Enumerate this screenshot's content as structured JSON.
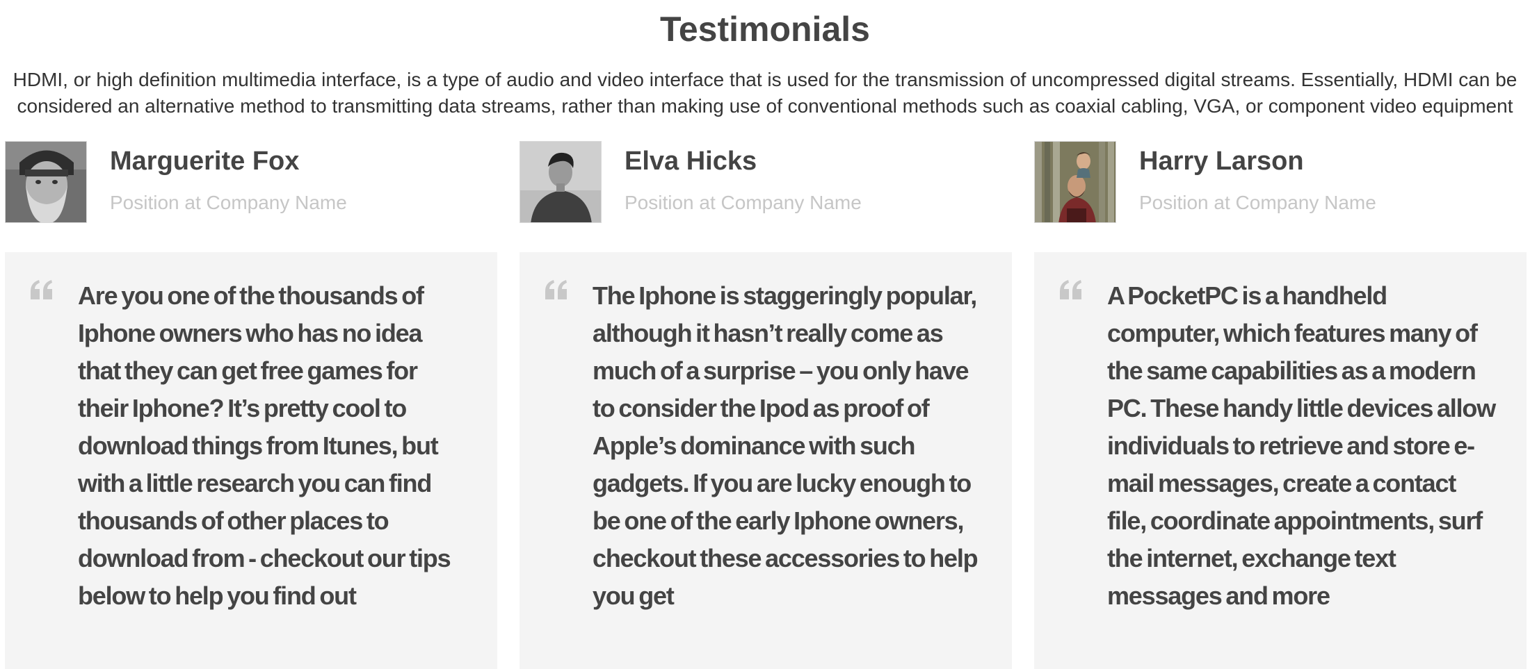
{
  "header": {
    "title": "Testimonials",
    "intro": "HDMI, or high definition multimedia interface, is a type of audio and video interface that is used for the transmission of uncompressed digital streams. Essentially, HDMI can be considered an alternative method to transmitting data streams, rather than making use of conventional methods such as coaxial cabling, VGA, or component video equipment"
  },
  "testimonials": [
    {
      "name": "Marguerite Fox",
      "position": "Position at Company Name",
      "avatar_icon": "person-photo-bearded-man-icon",
      "quote_icon": "quote-icon",
      "quote": "Are you one of the thousands of Iphone owners who has no idea that they can get free games for their Iphone? It’s pretty cool to download things from Itunes, but with a little research you can find thousands of other places to download from - checkout our tips below to help you find out"
    },
    {
      "name": "Elva Hicks",
      "position": "Position at Company Name",
      "avatar_icon": "person-photo-young-man-icon",
      "quote_icon": "quote-icon",
      "quote": "The Iphone is staggeringly popular, although it hasn’t really come as much of a surprise – you only have to consider the Ipod as proof of Apple’s dominance with such gadgets. If you are lucky enough to be one of the early Iphone owners, checkout these accessories to help you get"
    },
    {
      "name": "Harry Larson",
      "position": "Position at Company Name",
      "avatar_icon": "person-photo-man-with-child-icon",
      "quote_icon": "quote-icon",
      "quote": "A PocketPC is a handheld computer, which features many of the same capabilities as a modern PC. These handy little devices allow individuals to retrieve and store e-mail messages, create a contact file, coordinate appointments, surf the internet, exchange text messages and more"
    }
  ],
  "colors": {
    "text": "#444444",
    "muted": "#c6c6c6",
    "card_background": "#f4f4f4",
    "quote_icon": "#c8c8c8"
  }
}
